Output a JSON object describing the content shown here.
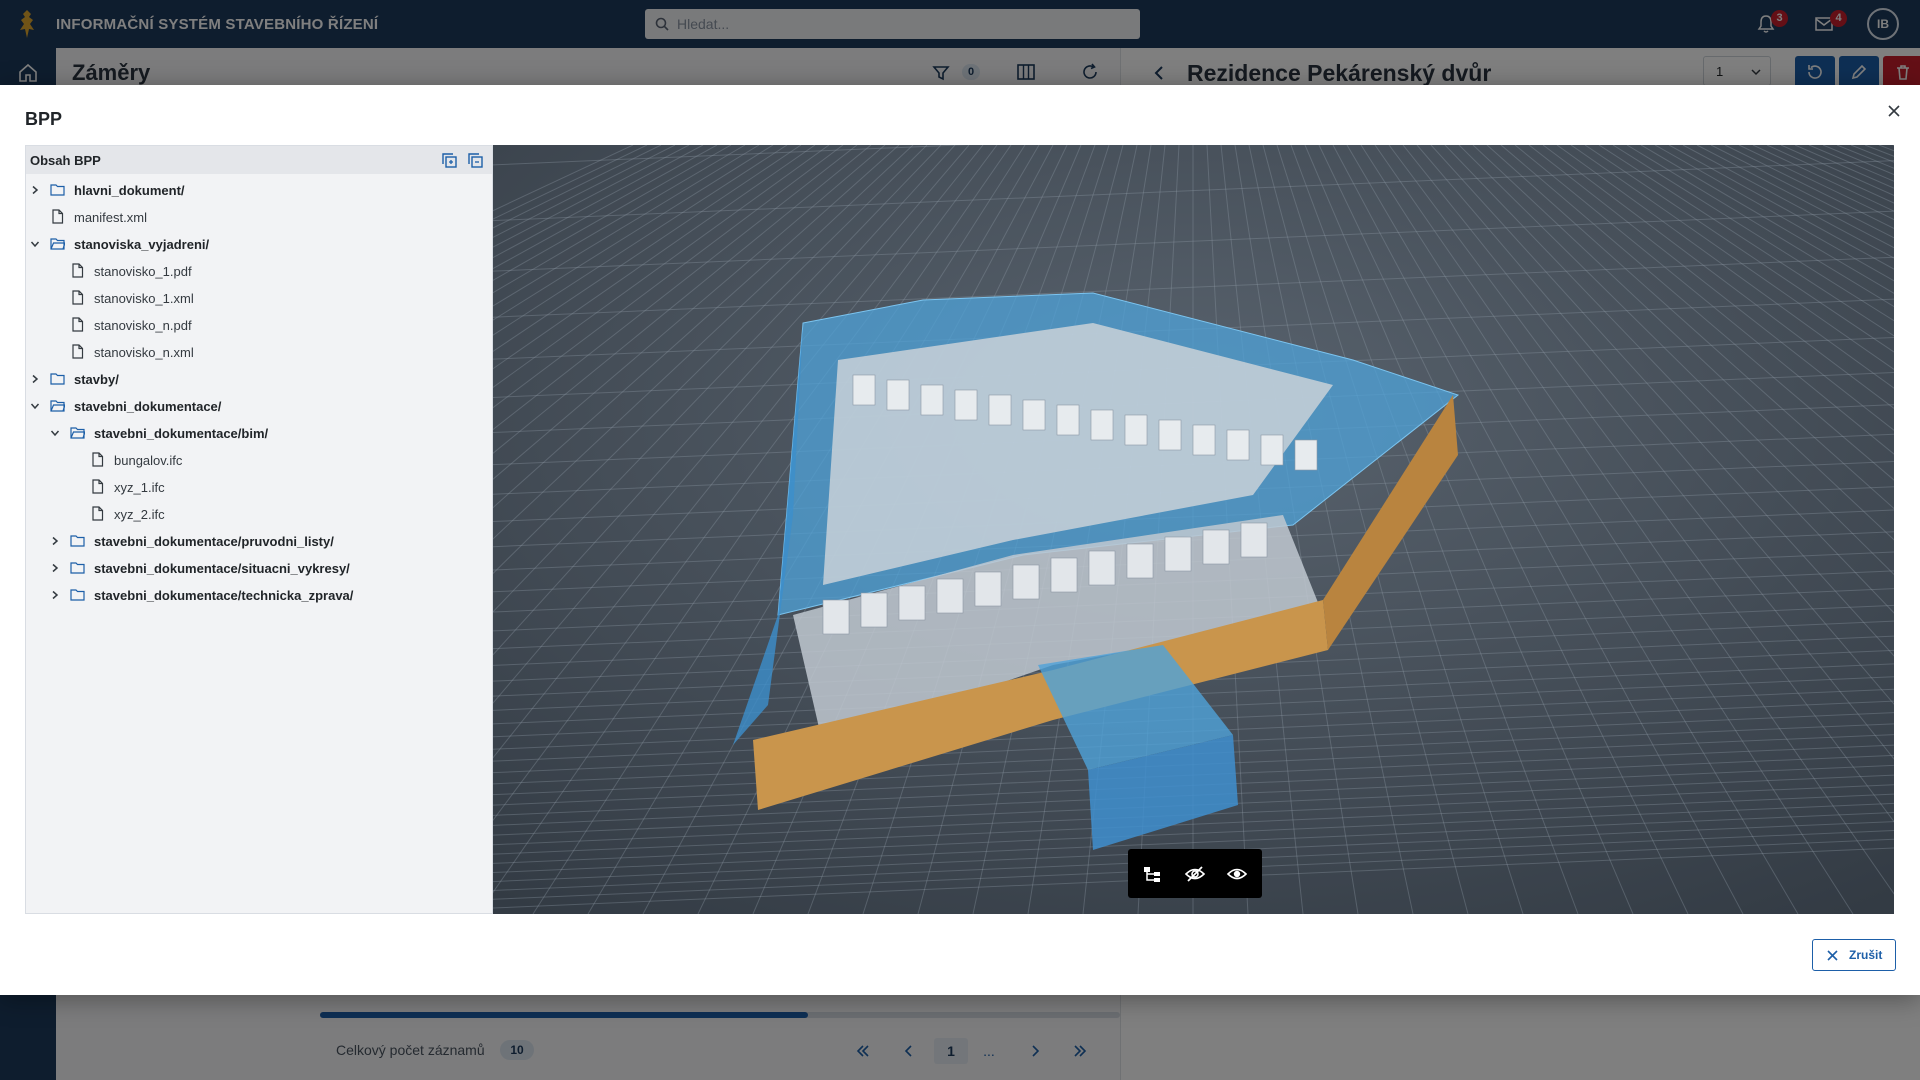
{
  "app": {
    "title": "INFORMAČNÍ SYSTÉM STAVEBNÍHO ŘÍZENÍ",
    "search_placeholder": "Hledat...",
    "notifications_count": "3",
    "messages_count": "4",
    "user_initials": "IB",
    "brand_color": "#1d3a5c",
    "accent_color": "#1d5fa8",
    "danger_color": "#c81e2c"
  },
  "list_panel": {
    "title": "Záměry",
    "filter_count": "0",
    "progress_fraction": 0.61,
    "total_label": "Celkový počet záznamů",
    "total_count": "10",
    "pagination": {
      "current_page": "1",
      "ellipsis": "..."
    }
  },
  "detail_panel": {
    "title": "Rezidence Pekárenský dvůr",
    "version_value": "1"
  },
  "modal": {
    "title": "BPP",
    "tree_header": "Obsah BPP",
    "cancel_label": "Zrušit",
    "tree": [
      {
        "name": "hlavni_dokument/",
        "type": "folder",
        "level": 0,
        "expanded": false
      },
      {
        "name": "manifest.xml",
        "type": "file",
        "level": 0
      },
      {
        "name": "stanoviska_vyjadreni/",
        "type": "folder",
        "level": 0,
        "expanded": true
      },
      {
        "name": "stanovisko_1.pdf",
        "type": "file",
        "level": 1
      },
      {
        "name": "stanovisko_1.xml",
        "type": "file",
        "level": 1
      },
      {
        "name": "stanovisko_n.pdf",
        "type": "file",
        "level": 1
      },
      {
        "name": "stanovisko_n.xml",
        "type": "file",
        "level": 1
      },
      {
        "name": "stavby/",
        "type": "folder",
        "level": 0,
        "expanded": false
      },
      {
        "name": "stavebni_dokumentace/",
        "type": "folder",
        "level": 0,
        "expanded": true
      },
      {
        "name": "stavebni_dokumentace/bim/",
        "type": "folder",
        "level": 1,
        "expanded": true
      },
      {
        "name": "bungalov.ifc",
        "type": "file",
        "level": 2
      },
      {
        "name": "xyz_1.ifc",
        "type": "file",
        "level": 2
      },
      {
        "name": "xyz_2.ifc",
        "type": "file",
        "level": 2
      },
      {
        "name": "stavebni_dokumentace/pruvodni_listy/",
        "type": "folder",
        "level": 1,
        "expanded": false
      },
      {
        "name": "stavebni_dokumentace/situacni_vykresy/",
        "type": "folder",
        "level": 1,
        "expanded": false
      },
      {
        "name": "stavebni_dokumentace/technicka_zprava/",
        "type": "folder",
        "level": 1,
        "expanded": false
      }
    ],
    "viewer_tools": [
      "tree-structure-icon",
      "eye-off-icon",
      "eye-icon"
    ]
  }
}
